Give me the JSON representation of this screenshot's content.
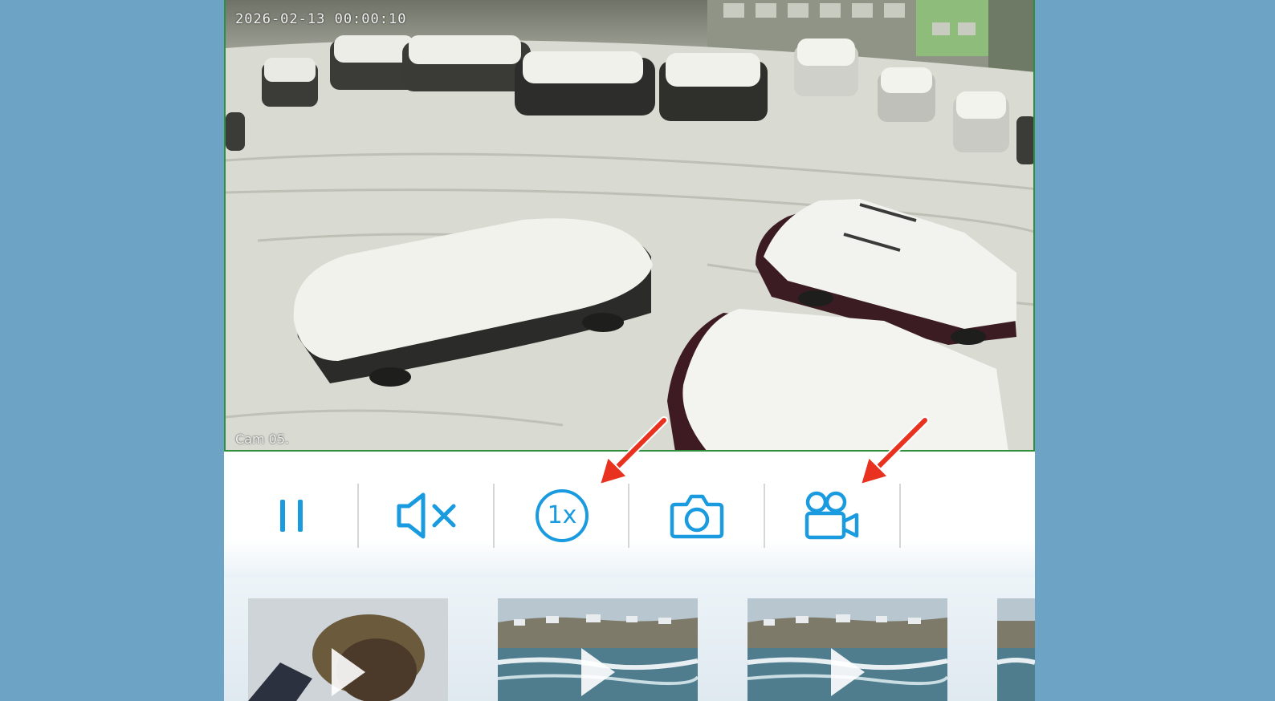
{
  "video": {
    "timestamp": "2026-02-13  00:00:10",
    "camera_name": "Cam 05."
  },
  "controls": [
    {
      "name": "pause-icon",
      "color": "#1a9be0"
    },
    {
      "name": "mute-icon",
      "color": "#1a9be0"
    },
    {
      "name": "speed-icon",
      "label": "1x",
      "color": "#1a9be0"
    },
    {
      "name": "snapshot-icon",
      "color": "#1a9be0"
    },
    {
      "name": "record-icon",
      "color": "#1a9be0"
    }
  ],
  "thumbnails": [
    {
      "name": "thumb-1",
      "scene": "person"
    },
    {
      "name": "thumb-2",
      "scene": "coast"
    },
    {
      "name": "thumb-3",
      "scene": "coast"
    },
    {
      "name": "thumb-4",
      "scene": "coast"
    }
  ],
  "colors": {
    "accent": "#1a9be0",
    "annotation_arrow": "#e8311e",
    "video_border": "#2f8f3a",
    "background": "#6da3c5"
  }
}
